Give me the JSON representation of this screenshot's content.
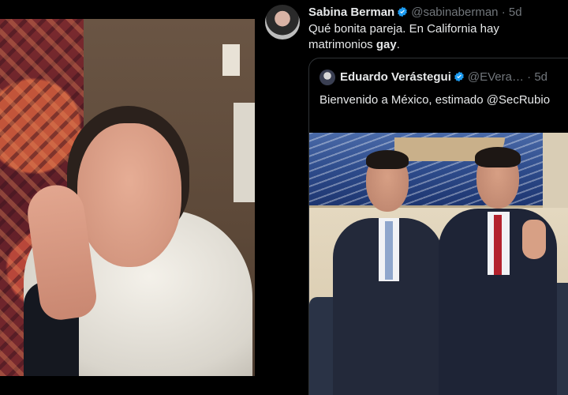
{
  "tweet": {
    "author": {
      "display_name": "Sabina Berman",
      "handle": "@sabinaberman",
      "separator": "·",
      "time": "5d"
    },
    "text_before_bold": "Qué bonita pareja.  En California hay matrimonios ",
    "text_bold": "gay",
    "text_after_bold": ".",
    "quoted": {
      "display_name": "Eduardo Verástegui",
      "handle": "@EVera…",
      "separator": "·",
      "time": "5d",
      "text": "Bienvenido a México, estimado @SecRubio"
    }
  },
  "icons": {
    "verified": "verified-badge-icon"
  },
  "colors": {
    "background": "#000000",
    "text_primary": "#e7e9ea",
    "text_secondary": "#71767b",
    "verified_blue": "#1d9bf0",
    "border": "#2f3336"
  }
}
